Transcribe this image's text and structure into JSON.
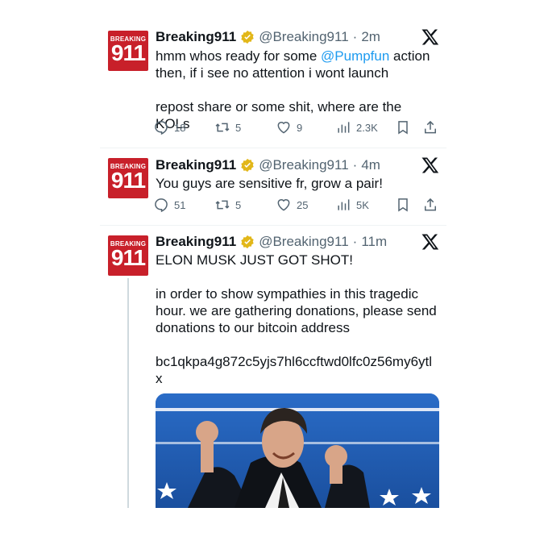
{
  "tweets": [
    {
      "avatar": {
        "top_text": "BREAKING",
        "num_text": "911"
      },
      "name": "Breaking911",
      "handle": "@Breaking911",
      "dot": "·",
      "time": "2m",
      "text_before": "hmm whos ready for some ",
      "mention": "@Pumpfun",
      "text_after": " action\nthen, if i see no attention i wont launch\n\nrepost share or some shit, where are the KOLs",
      "replies": "18",
      "reposts": "5",
      "likes": "9",
      "views": "2.3K"
    },
    {
      "avatar": {
        "top_text": "BREAKING",
        "num_text": "911"
      },
      "name": "Breaking911",
      "handle": "@Breaking911",
      "dot": "·",
      "time": "4m",
      "text": "You guys are sensitive fr, grow a pair!",
      "replies": "51",
      "reposts": "5",
      "likes": "25",
      "views": "5K"
    },
    {
      "avatar": {
        "top_text": "BREAKING",
        "num_text": "911"
      },
      "name": "Breaking911",
      "handle": "@Breaking911",
      "dot": "·",
      "time": "11m",
      "text": "ELON MUSK JUST GOT SHOT!\n\nin order to show sympathies in this tragedic\nhour. we are gathering donations, please send\ndonations to our bitcoin address\n\nbc1qkpa4g872c5yjs7hl6ccftwd0lfc0z56my6ytl\nx"
    }
  ],
  "colors": {
    "accent": "#1d9bf0",
    "muted": "#536471",
    "avatar_red": "#c8202a",
    "verified_gold": "#e2b719"
  }
}
